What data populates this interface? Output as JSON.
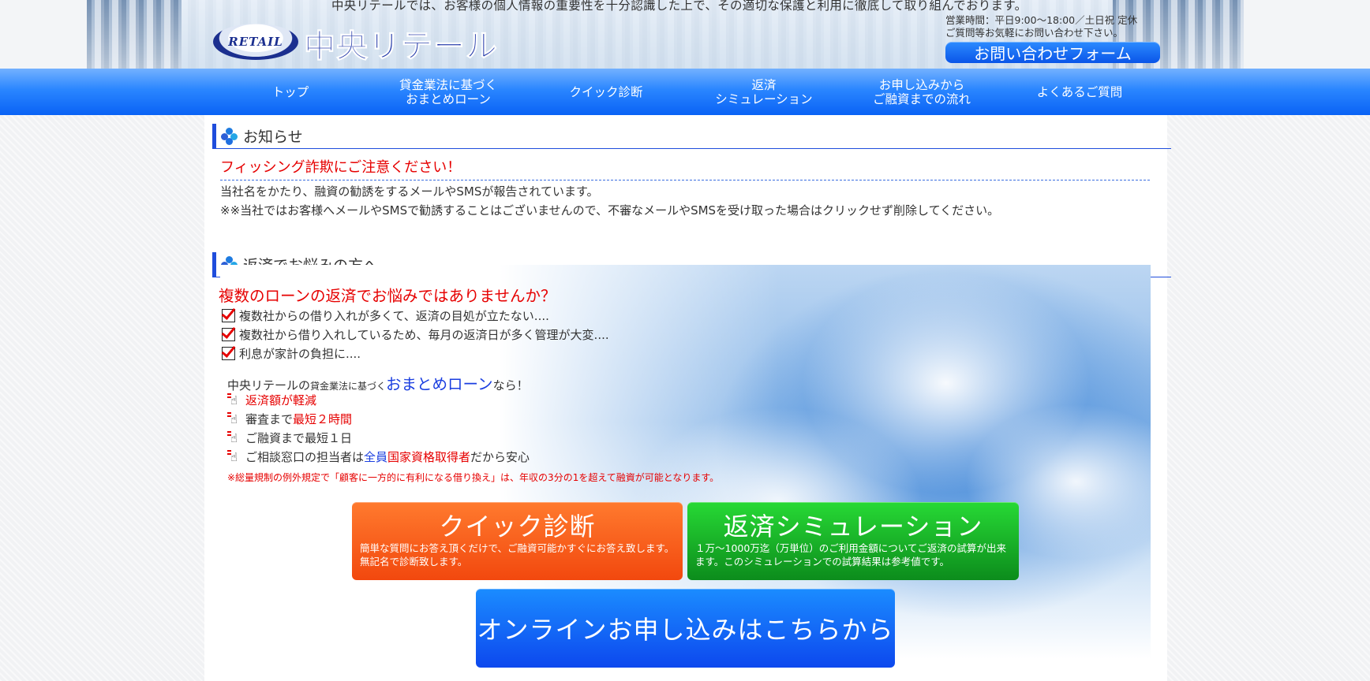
{
  "header": {
    "tagline": "中央リテールでは、お客様の個人情報の重要性を十分認識した上で、その適切な保護と利用に徹底して取り組んでおります。",
    "logo_badge": "RETAIL",
    "logo_text": "中央リテール",
    "hours_line1": "営業時間：平日9:00〜18:00／土日祝 定休",
    "hours_line2": "ご質問等お気軽にお問い合わせ下さい。",
    "contact_button": "お問い合わせフォーム"
  },
  "nav": {
    "items": [
      {
        "label": "トップ"
      },
      {
        "label": "貸金業法に基づく\nおまとめローン"
      },
      {
        "label": "クイック診断"
      },
      {
        "label": "返済\nシミュレーション"
      },
      {
        "label": "お申し込みから\nご融資までの流れ"
      },
      {
        "label": "よくあるご質問"
      }
    ]
  },
  "notice": {
    "heading": "お知らせ",
    "title": "フィッシング詐欺にご注意ください！",
    "line1": "当社名をかたり、融資の勧誘をするメールやSMSが報告されています。",
    "line2": "※※当社ではお客様へメールやSMSで勧誘することはございませんので、不審なメールやSMSを受け取った場合はクリックせず削除してください。"
  },
  "worries": {
    "heading": "返済でお悩みの方へ",
    "title": "複数のローンの返済でお悩みではありませんか？",
    "checks": [
      "複数社からの借り入れが多くて、返済の目処が立たない....",
      "複数社から借り入れしているため、毎月の返済日が多く管理が大変....",
      "利息が家計の負担に...."
    ],
    "pitch_prefix": "中央リテールの",
    "pitch_small": "貸金業法に基づく",
    "pitch_big": "おまとめローン",
    "pitch_suffix": "なら！",
    "points": {
      "p1": "返済額が軽減",
      "p2_a": "審査まで",
      "p2_b": "最短２時間",
      "p3": "ご融資まで最短１日",
      "p4_a": "ご相談窓口の担当者は",
      "p4_b": "全員",
      "p4_c": "国家資格取得者",
      "p4_d": "だから安心"
    },
    "note": "※総量規制の例外規定で「顧客に一方的に有利になる借り換え」は、年収の3分の1を超えて融資が可能となります。"
  },
  "cta": {
    "quick_title": "クイック診断",
    "quick_desc": "簡単な質問にお答え頂くだけで、ご融資可能かすぐにお答え致します。無記名で診断致します。",
    "sim_title": "返済シミュレーション",
    "sim_desc": "１万〜1000万迄（万単位）のご利用金額についてご返済の試算が出来ます。このシミュレーションでの試算結果は参考値です。",
    "apply_label": "オンラインお申し込みはこちらから"
  },
  "colors": {
    "accent_red": "#e60000",
    "nav_blue": "#2a86ff",
    "quick_orange": "#f2480e",
    "sim_green": "#0c8c1c",
    "apply_blue": "#0d48ee"
  }
}
